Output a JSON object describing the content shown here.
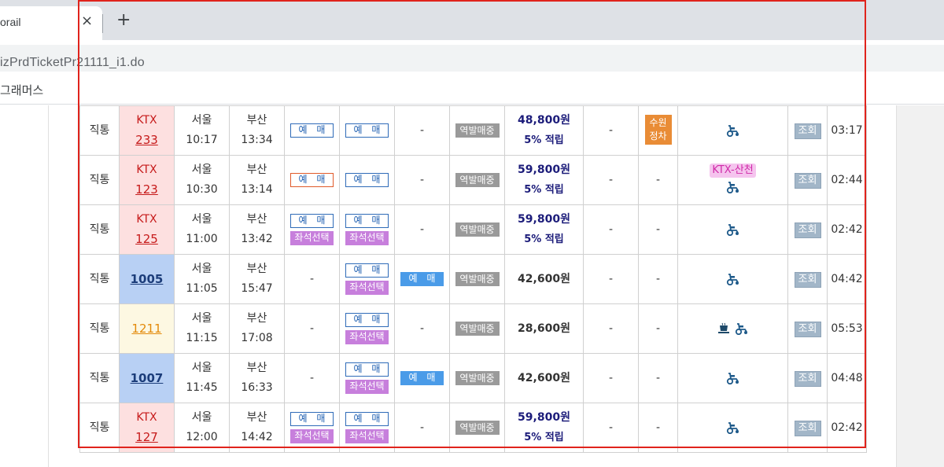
{
  "browser": {
    "tab_title": "orail",
    "close_glyph": "×",
    "new_tab_glyph": "+",
    "url_fragment": "izPrdTicketPr21111_i1.do",
    "bookmark_label": "그래머스"
  },
  "table": {
    "rows": [
      {
        "type": "직통",
        "train_kind": "KTX",
        "train_no": "233",
        "train_style": "ktx",
        "dep_station": "서울",
        "dep_time": "10:17",
        "arr_station": "부산",
        "arr_time": "13:34",
        "special": {
          "book": "예 매",
          "seat": ""
        },
        "general": {
          "book": "예 매",
          "seat": ""
        },
        "standing": "-",
        "reserve": "역발매중",
        "price": "48,800원",
        "point": "5% 적립",
        "mileage": "-",
        "event": "수원정차",
        "info_label": "",
        "info_icons": [
          "wheelchair-icon"
        ],
        "query": "조회",
        "duration": "03:17"
      },
      {
        "type": "직통",
        "train_kind": "KTX",
        "train_no": "123",
        "train_style": "ktx",
        "dep_station": "서울",
        "dep_time": "10:30",
        "arr_station": "부산",
        "arr_time": "13:14",
        "special": {
          "book": "예 매",
          "seat": "",
          "selected": true
        },
        "general": {
          "book": "예 매",
          "seat": ""
        },
        "standing": "-",
        "reserve": "역발매중",
        "price": "59,800원",
        "point": "5% 적립",
        "mileage": "-",
        "event": "-",
        "info_label": "KTX-산천",
        "info_icons": [
          "wheelchair-icon"
        ],
        "query": "조회",
        "duration": "02:44"
      },
      {
        "type": "직통",
        "train_kind": "KTX",
        "train_no": "125",
        "train_style": "ktx",
        "dep_station": "서울",
        "dep_time": "11:00",
        "arr_station": "부산",
        "arr_time": "13:42",
        "special": {
          "book": "예 매",
          "seat": "좌석선택"
        },
        "general": {
          "book": "예 매",
          "seat": "좌석선택"
        },
        "standing": "-",
        "reserve": "역발매중",
        "price": "59,800원",
        "point": "5% 적립",
        "mileage": "-",
        "event": "-",
        "info_label": "",
        "info_icons": [
          "wheelchair-icon"
        ],
        "query": "조회",
        "duration": "02:42"
      },
      {
        "type": "직통",
        "train_kind": "",
        "train_no": "1005",
        "train_style": "mugung",
        "dep_station": "서울",
        "dep_time": "11:05",
        "arr_station": "부산",
        "arr_time": "15:47",
        "special": {
          "none": "-"
        },
        "general": {
          "book": "예 매",
          "seat": "좌석선택"
        },
        "standing": {
          "book": "예 매"
        },
        "reserve": "역발매중",
        "price": "42,600원",
        "point": "",
        "mileage": "-",
        "event": "-",
        "info_label": "",
        "info_icons": [
          "wheelchair-icon"
        ],
        "query": "조회",
        "duration": "04:42"
      },
      {
        "type": "직통",
        "train_kind": "",
        "train_no": "1211",
        "train_style": "itx",
        "dep_station": "서울",
        "dep_time": "11:15",
        "arr_station": "부산",
        "arr_time": "17:08",
        "special": {
          "none": "-"
        },
        "general": {
          "book": "예 매",
          "seat": "좌석선택"
        },
        "standing": "-",
        "reserve": "역발매중",
        "price": "28,600원",
        "point": "",
        "mileage": "-",
        "event": "-",
        "info_label": "",
        "info_icons": [
          "cafe-icon",
          "wheelchair-icon"
        ],
        "query": "조회",
        "duration": "05:53"
      },
      {
        "type": "직통",
        "train_kind": "",
        "train_no": "1007",
        "train_style": "mugung",
        "dep_station": "서울",
        "dep_time": "11:45",
        "arr_station": "부산",
        "arr_time": "16:33",
        "special": {
          "none": "-"
        },
        "general": {
          "book": "예 매",
          "seat": "좌석선택"
        },
        "standing": {
          "book": "예 매"
        },
        "reserve": "역발매중",
        "price": "42,600원",
        "point": "",
        "mileage": "-",
        "event": "-",
        "info_label": "",
        "info_icons": [
          "wheelchair-icon"
        ],
        "query": "조회",
        "duration": "04:48"
      },
      {
        "type": "직통",
        "train_kind": "KTX",
        "train_no": "127",
        "train_style": "ktx",
        "dep_station": "서울",
        "dep_time": "12:00",
        "arr_station": "부산",
        "arr_time": "14:42",
        "special": {
          "book": "예 매",
          "seat": "좌석선택"
        },
        "general": {
          "book": "예 매",
          "seat": "좌석선택"
        },
        "standing": "-",
        "reserve": "역발매중",
        "price": "59,800원",
        "point": "5% 적립",
        "mileage": "-",
        "event": "-",
        "info_label": "",
        "info_icons": [
          "wheelchair-icon"
        ],
        "query": "조회",
        "duration": "02:42"
      }
    ]
  },
  "colors": {
    "highlight_frame": "#e0231c",
    "ktx_bg": "#fde0e0",
    "mugung_bg": "#b8d0f4",
    "itx_bg": "#fdf8e2",
    "seat_button": "#c77fdc",
    "book_filled": "#4a9be8"
  }
}
